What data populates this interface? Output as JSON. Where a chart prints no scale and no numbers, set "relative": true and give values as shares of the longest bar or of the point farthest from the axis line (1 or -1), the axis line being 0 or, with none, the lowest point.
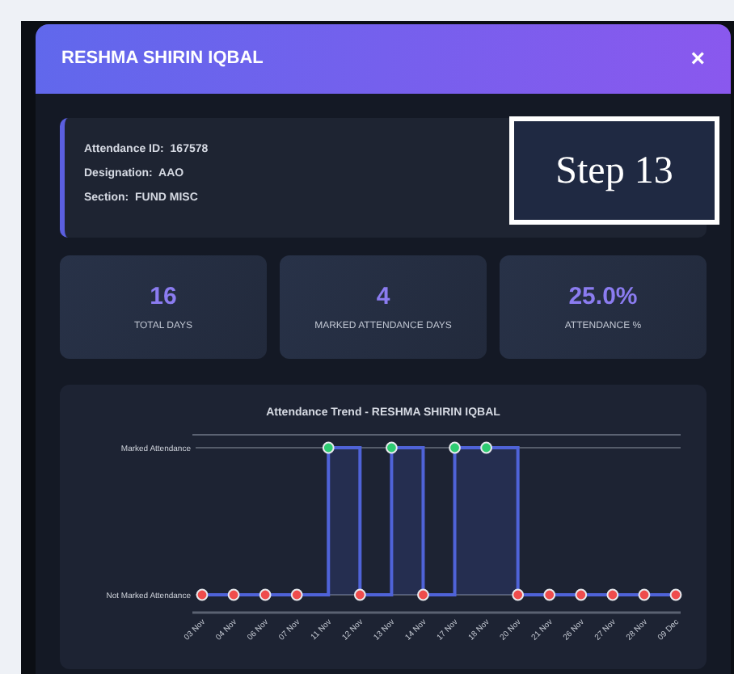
{
  "modal": {
    "title": "RESHMA SHIRIN IQBAL",
    "close": "×"
  },
  "details": [
    {
      "label": "Attendance ID:",
      "value": "167578"
    },
    {
      "label": "Designation:",
      "value": "AAO"
    },
    {
      "label": "Section:",
      "value": "FUND MISC"
    }
  ],
  "annotation": {
    "text": "Step 13"
  },
  "stats": [
    {
      "value": "16",
      "label": "TOTAL DAYS"
    },
    {
      "value": "4",
      "label": "MARKED ATTENDANCE DAYS"
    },
    {
      "value": "25.0%",
      "label": "ATTENDANCE %"
    }
  ],
  "chart": {
    "chart_data": {
      "type": "area",
      "relative": true,
      "title": "Attendance Trend - RESHMA SHIRIN IQBAL",
      "categories": [
        "03 Nov",
        "04 Nov",
        "06 Nov",
        "07 Nov",
        "11 Nov",
        "12 Nov",
        "13 Nov",
        "14 Nov",
        "17 Nov",
        "18 Nov",
        "20 Nov",
        "21 Nov",
        "26 Nov",
        "27 Nov",
        "28 Nov",
        "09 Dec"
      ],
      "series": [
        {
          "color": "#4f63d8",
          "marker": "o",
          "values": [
            0,
            0,
            0,
            0,
            1,
            0,
            1,
            0,
            1,
            1,
            0,
            0,
            0,
            0,
            0,
            0
          ]
        }
      ],
      "y_categories": [
        "Not Marked Attendance",
        "Marked Attendance"
      ]
    }
  }
}
